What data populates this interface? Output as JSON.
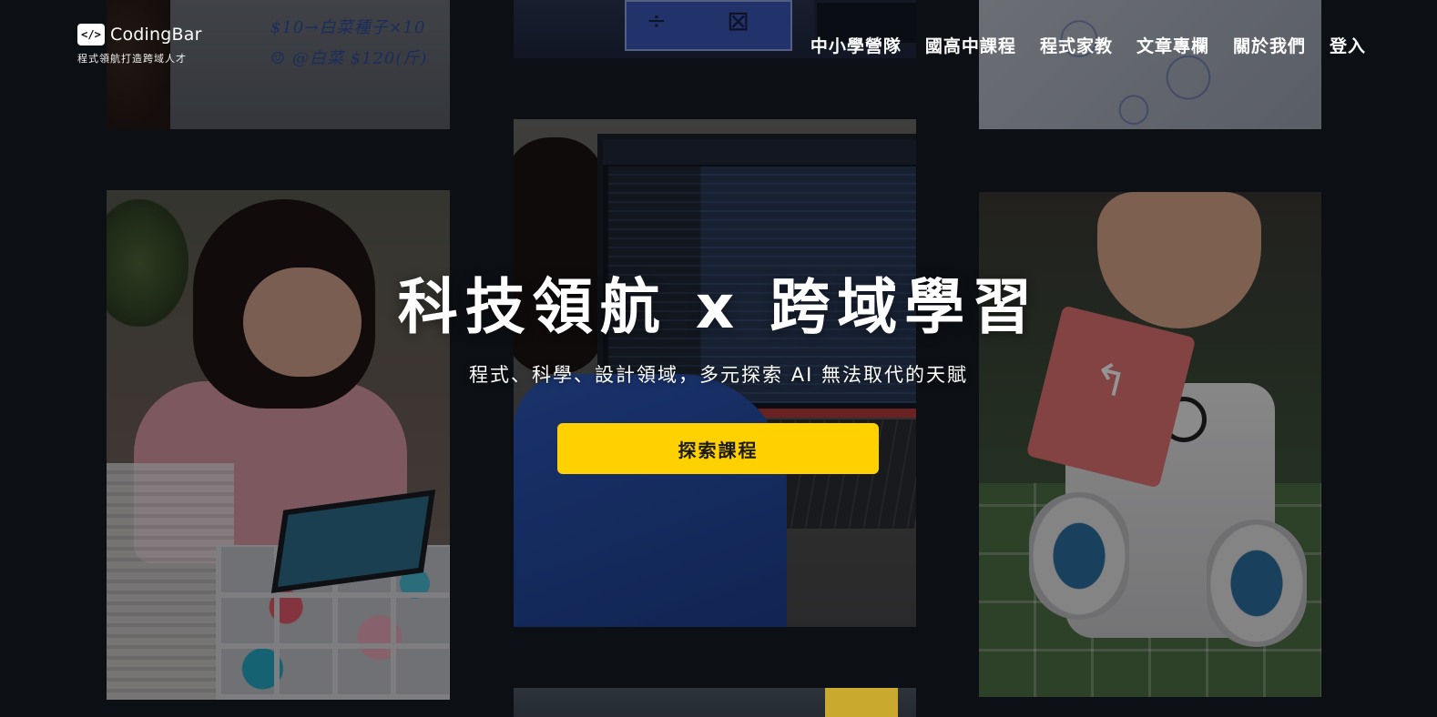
{
  "brand": {
    "icon_glyph": "</>",
    "name": "CodingBar",
    "tagline": "程式領航打造跨域人才"
  },
  "nav": {
    "items": [
      "中小學營隊",
      "國高中課程",
      "程式家教",
      "文章專欄",
      "關於我們",
      "登入"
    ]
  },
  "hero": {
    "title": "科技領航 x 跨域學習",
    "subtitle": "程式、科學、設計領域，多元探索 AI 無法取代的天賦",
    "cta_label": "探索課程"
  },
  "colors": {
    "background": "#0c0f14",
    "cta": "#ffd100",
    "text": "#ffffff"
  }
}
